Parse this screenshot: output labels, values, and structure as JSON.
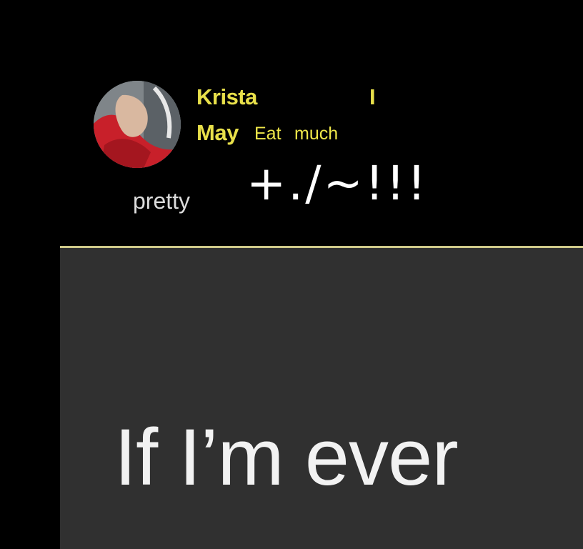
{
  "header": {
    "name": "Krista",
    "cursor_mark": "I",
    "month": "May",
    "caption_word_1": "Eat",
    "caption_word_2": "much",
    "symbols": "+./~!!!",
    "label": "pretty"
  },
  "avatar": {
    "icon": "profile-photo"
  },
  "post": {
    "text": "If I’m ever"
  },
  "colors": {
    "background": "#000000",
    "name_yellow": "#e8e04a",
    "caption_yellow": "#f0e84a",
    "divider": "#cfc98a",
    "card": "#303030",
    "card_text": "#f2f2f2"
  }
}
